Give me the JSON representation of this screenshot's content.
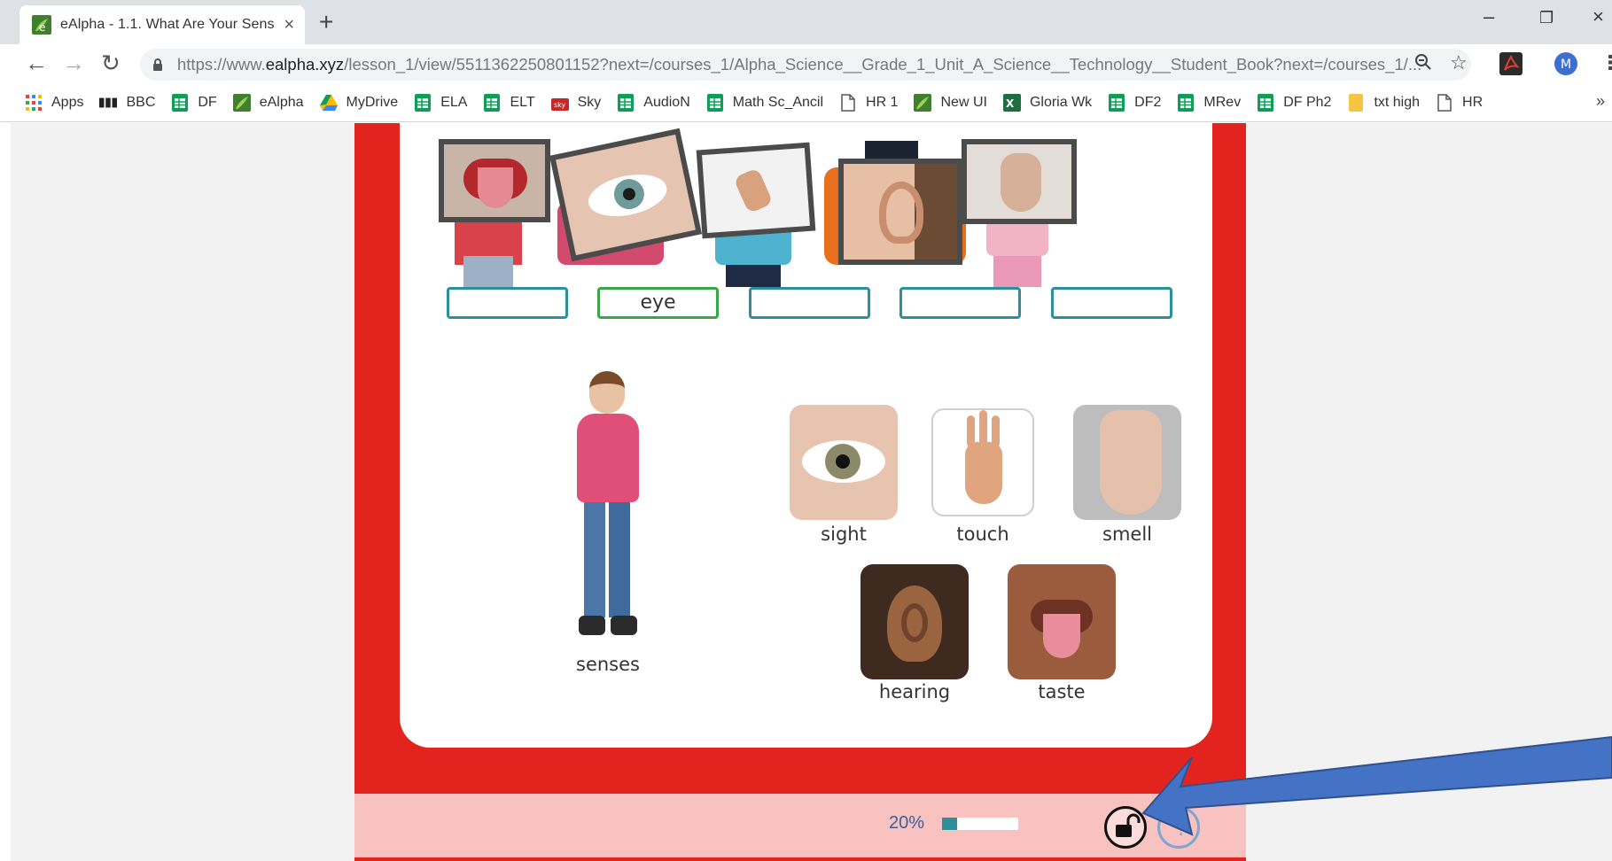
{
  "browser": {
    "tab": {
      "title": "eAlpha - 1.1. What Are Your Sens",
      "close": "×"
    },
    "new_tab": "+",
    "window_controls": {
      "minimize": "–",
      "restore": "❐",
      "close": "×"
    },
    "url": {
      "prefix": "https://www.",
      "domain": "ealpha.xyz",
      "path": "/lesson_1/view/5511362250801152?next=/courses_1/Alpha_Science__Grade_1_Unit_A_Science__Technology__Student_Book?next=/courses_1/..."
    },
    "profile_initial": "M",
    "bookmarks": [
      {
        "label": "Apps",
        "icon": "apps-grid-icon"
      },
      {
        "label": "BBC",
        "icon": "bbc-icon"
      },
      {
        "label": "DF",
        "icon": "sheets-icon"
      },
      {
        "label": "eAlpha",
        "icon": "ealpha-icon"
      },
      {
        "label": "MyDrive",
        "icon": "drive-icon"
      },
      {
        "label": "ELA",
        "icon": "sheets-icon"
      },
      {
        "label": "ELT",
        "icon": "sheets-icon"
      },
      {
        "label": "Sky",
        "icon": "sky-icon"
      },
      {
        "label": "AudioN",
        "icon": "sheets-icon"
      },
      {
        "label": "Math Sc_Ancil",
        "icon": "sheets-icon"
      },
      {
        "label": "HR 1",
        "icon": "page-icon"
      },
      {
        "label": "New UI",
        "icon": "ealpha-icon"
      },
      {
        "label": "Gloria Wk",
        "icon": "excel-icon"
      },
      {
        "label": "DF2",
        "icon": "sheets-icon"
      },
      {
        "label": "MRev",
        "icon": "sheets-icon"
      },
      {
        "label": "DF Ph2",
        "icon": "sheets-icon"
      },
      {
        "label": "txt high",
        "icon": "folder-icon"
      },
      {
        "label": "HR",
        "icon": "page-icon"
      }
    ],
    "bookmarks_more": "»"
  },
  "lesson": {
    "answers": [
      "",
      "eye",
      "",
      "",
      ""
    ],
    "senses_label": "senses",
    "sense_words": [
      "sight",
      "touch",
      "smell",
      "hearing",
      "taste"
    ]
  },
  "progress": {
    "label": "20%",
    "value": 0.2
  },
  "colors": {
    "panel_red": "#e3241e",
    "progress_pink": "#f7c2c0",
    "teal": "#2e8e99",
    "green": "#3aa64a",
    "arrow_blue": "#4472c4"
  }
}
